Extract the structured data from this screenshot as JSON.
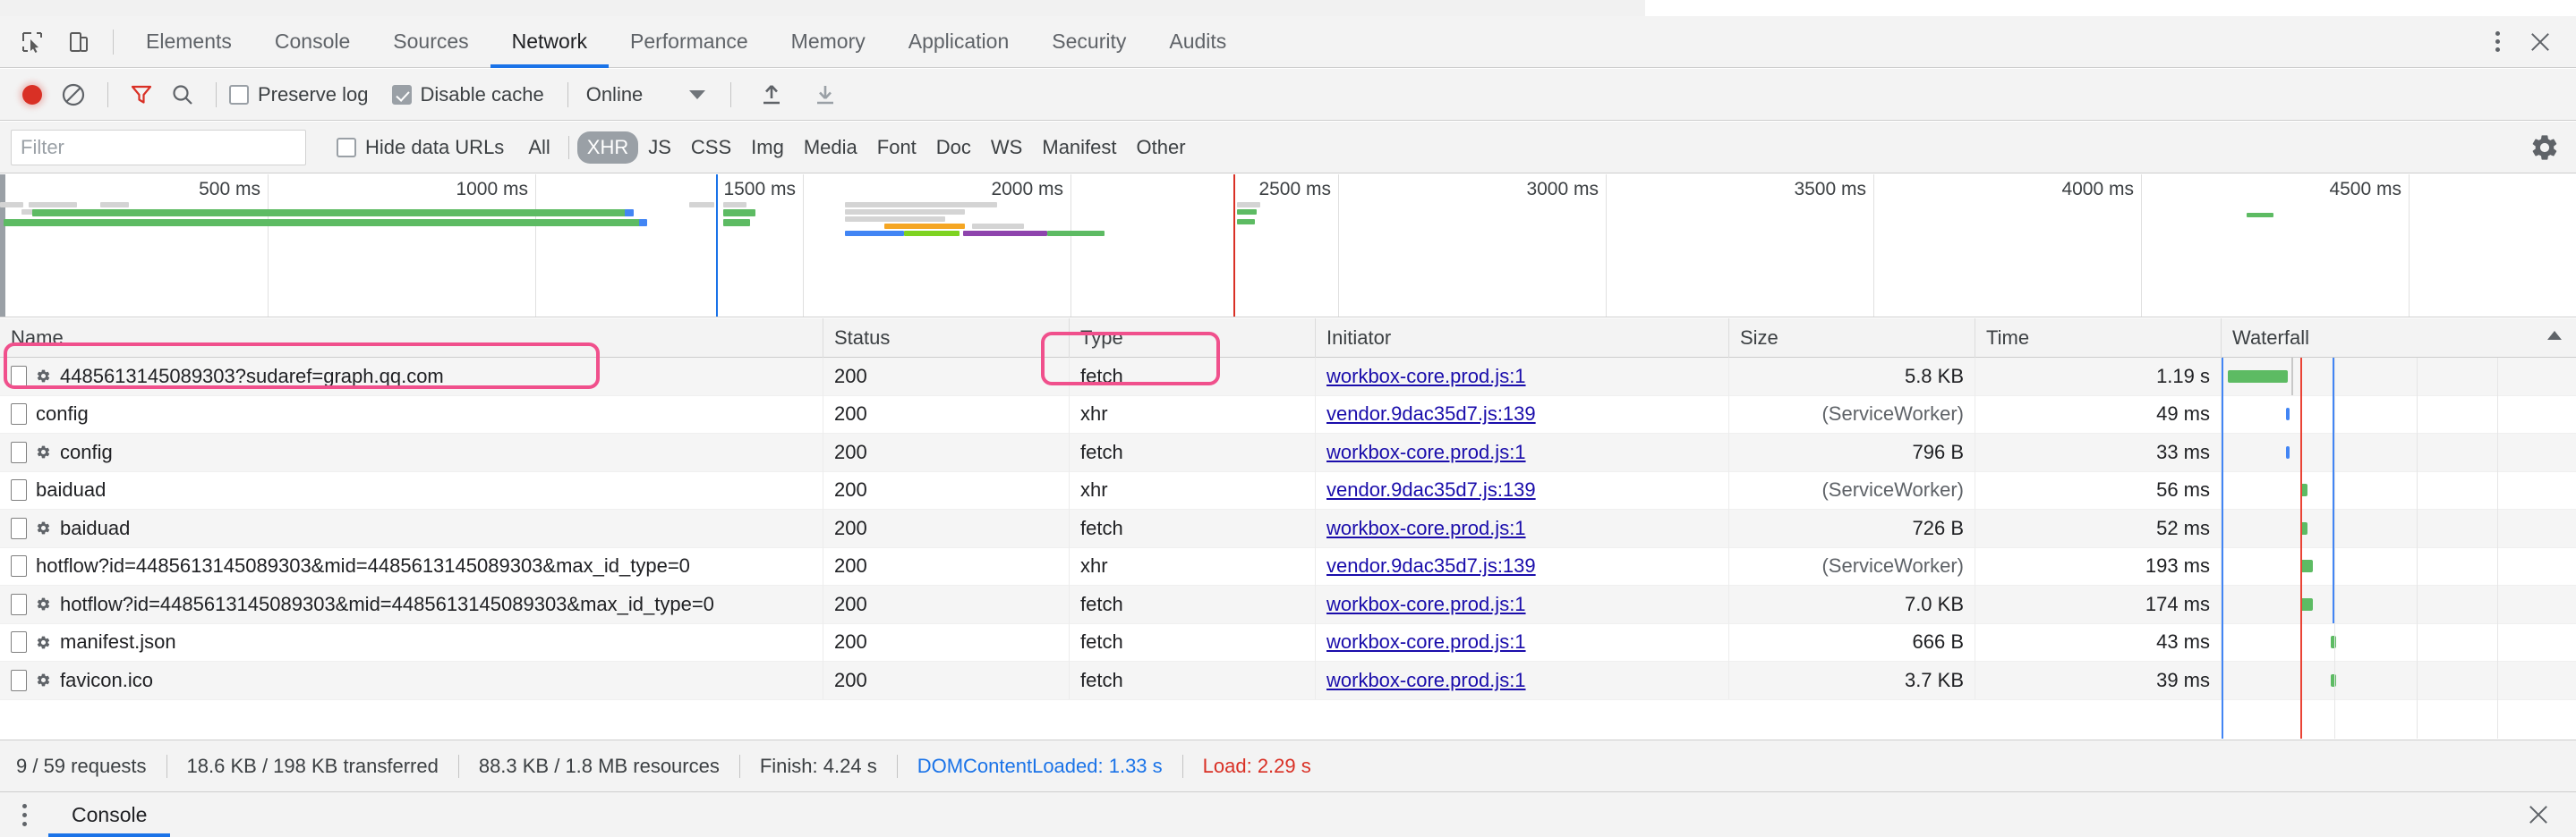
{
  "window": {
    "panel_tabs": [
      {
        "label": "Elements",
        "active": false
      },
      {
        "label": "Console",
        "active": false
      },
      {
        "label": "Sources",
        "active": false
      },
      {
        "label": "Network",
        "active": true
      },
      {
        "label": "Performance",
        "active": false
      },
      {
        "label": "Memory",
        "active": false
      },
      {
        "label": "Application",
        "active": false
      },
      {
        "label": "Security",
        "active": false
      },
      {
        "label": "Audits",
        "active": false
      }
    ],
    "inspect_icon": "inspect-element-icon",
    "device_icon": "toggle-device-toolbar-icon",
    "more_icon": "kebab-menu-icon",
    "close_icon": "close-icon"
  },
  "controls": {
    "record_icon": "record-button-icon",
    "clear_icon": "clear-icon",
    "filter_icon": "filter-funnel-icon",
    "search_icon": "search-icon",
    "preserve_log": {
      "label": "Preserve log",
      "checked": false
    },
    "disable_cache": {
      "label": "Disable cache",
      "checked": true
    },
    "throttle": {
      "value": "Online",
      "caret_icon": "chevron-down-icon"
    },
    "import_icon": "import-har-icon",
    "export_icon": "export-har-icon",
    "settings_icon": "gear-icon"
  },
  "filters": {
    "search": {
      "placeholder": "Filter",
      "value": ""
    },
    "hide_data_urls": {
      "label": "Hide data URLs",
      "checked": false
    },
    "types": [
      {
        "label": "All",
        "selected": false
      },
      {
        "label": "XHR",
        "selected": true
      },
      {
        "label": "JS",
        "selected": false
      },
      {
        "label": "CSS",
        "selected": false
      },
      {
        "label": "Img",
        "selected": false
      },
      {
        "label": "Media",
        "selected": false
      },
      {
        "label": "Font",
        "selected": false
      },
      {
        "label": "Doc",
        "selected": false
      },
      {
        "label": "WS",
        "selected": false
      },
      {
        "label": "Manifest",
        "selected": false
      },
      {
        "label": "Other",
        "selected": false
      }
    ]
  },
  "overview": {
    "ticks": [
      "500 ms",
      "1000 ms",
      "1500 ms",
      "2000 ms",
      "2500 ms",
      "3000 ms",
      "3500 ms",
      "4000 ms",
      "4500 ms"
    ],
    "accent_blue": "#1a73e8",
    "accent_red": "#d93025",
    "bar_green": "#4caf50"
  },
  "table": {
    "columns": [
      {
        "key": "name",
        "label": "Name",
        "align": "left"
      },
      {
        "key": "status",
        "label": "Status",
        "align": "left"
      },
      {
        "key": "type",
        "label": "Type",
        "align": "left"
      },
      {
        "key": "initiator",
        "label": "Initiator",
        "align": "left"
      },
      {
        "key": "size",
        "label": "Size",
        "align": "right"
      },
      {
        "key": "time",
        "label": "Time",
        "align": "right"
      },
      {
        "key": "waterfall",
        "label": "Waterfall",
        "align": "left"
      }
    ],
    "sort_indicator": "sort-ascending-caret-icon",
    "rows": [
      {
        "name": "4485613145089303?sudaref=graph.qq.com",
        "has_gear": true,
        "status": "200",
        "type": "fetch",
        "initiator": "workbox-core.prod.js:1",
        "size": "5.8 KB",
        "time": "1.19 s",
        "wf_start_pct": 1.0,
        "wf_width_pct": 8.0,
        "wf_color": "#4caf50"
      },
      {
        "name": "config",
        "has_gear": false,
        "status": "200",
        "type": "xhr",
        "initiator": "vendor.9dac35d7.js:139",
        "size": "(ServiceWorker)",
        "time": "49 ms",
        "wf_start_pct": 32.5,
        "wf_width_pct": 0.5,
        "wf_color": "#4285f4"
      },
      {
        "name": "config",
        "has_gear": true,
        "status": "200",
        "type": "fetch",
        "initiator": "workbox-core.prod.js:1",
        "size": "796 B",
        "time": "33 ms",
        "wf_start_pct": 32.5,
        "wf_width_pct": 0.5,
        "wf_color": "#4285f4"
      },
      {
        "name": "baiduad",
        "has_gear": false,
        "status": "200",
        "type": "xhr",
        "initiator": "vendor.9dac35d7.js:139",
        "size": "(ServiceWorker)",
        "time": "56 ms",
        "wf_start_pct": 41.0,
        "wf_width_pct": 0.55,
        "wf_color": "#4caf50"
      },
      {
        "name": "baiduad",
        "has_gear": true,
        "status": "200",
        "type": "fetch",
        "initiator": "workbox-core.prod.js:1",
        "size": "726 B",
        "time": "52 ms",
        "wf_start_pct": 41.0,
        "wf_width_pct": 0.55,
        "wf_color": "#4caf50"
      },
      {
        "name": "hotflow?id=4485613145089303&mid=4485613145089303&max_id_type=0",
        "has_gear": false,
        "status": "200",
        "type": "xhr",
        "initiator": "vendor.9dac35d7.js:139",
        "size": "(ServiceWorker)",
        "time": "193 ms",
        "wf_start_pct": 41.5,
        "wf_width_pct": 1.1,
        "wf_color": "#4caf50"
      },
      {
        "name": "hotflow?id=4485613145089303&mid=4485613145089303&max_id_type=0",
        "has_gear": true,
        "status": "200",
        "type": "fetch",
        "initiator": "workbox-core.prod.js:1",
        "size": "7.0 KB",
        "time": "174 ms",
        "wf_start_pct": 41.5,
        "wf_width_pct": 1.1,
        "wf_color": "#4caf50"
      },
      {
        "name": "manifest.json",
        "has_gear": true,
        "status": "200",
        "type": "fetch",
        "initiator": "workbox-core.prod.js:1",
        "size": "666 B",
        "time": "43 ms",
        "wf_start_pct": 63.0,
        "wf_width_pct": 0.45,
        "wf_color": "#4caf50"
      },
      {
        "name": "favicon.ico",
        "has_gear": true,
        "status": "200",
        "type": "fetch",
        "initiator": "workbox-core.prod.js:1",
        "size": "3.7 KB",
        "time": "39 ms",
        "wf_start_pct": 63.5,
        "wf_width_pct": 0.45,
        "wf_color": "#4caf50"
      }
    ]
  },
  "summary": {
    "requests": "9 / 59 requests",
    "transferred": "18.6 KB / 198 KB transferred",
    "resources": "88.3 KB / 1.8 MB resources",
    "finish": "Finish: 4.24 s",
    "dom_content_loaded": "DOMContentLoaded: 1.33 s",
    "load": "Load: 2.29 s"
  },
  "drawer": {
    "kebab_icon": "kebab-menu-icon",
    "tab_label": "Console",
    "close_icon": "close-icon"
  },
  "annotations": [
    {
      "name": "name-cell-highlight"
    },
    {
      "name": "type-cell-highlight"
    }
  ]
}
